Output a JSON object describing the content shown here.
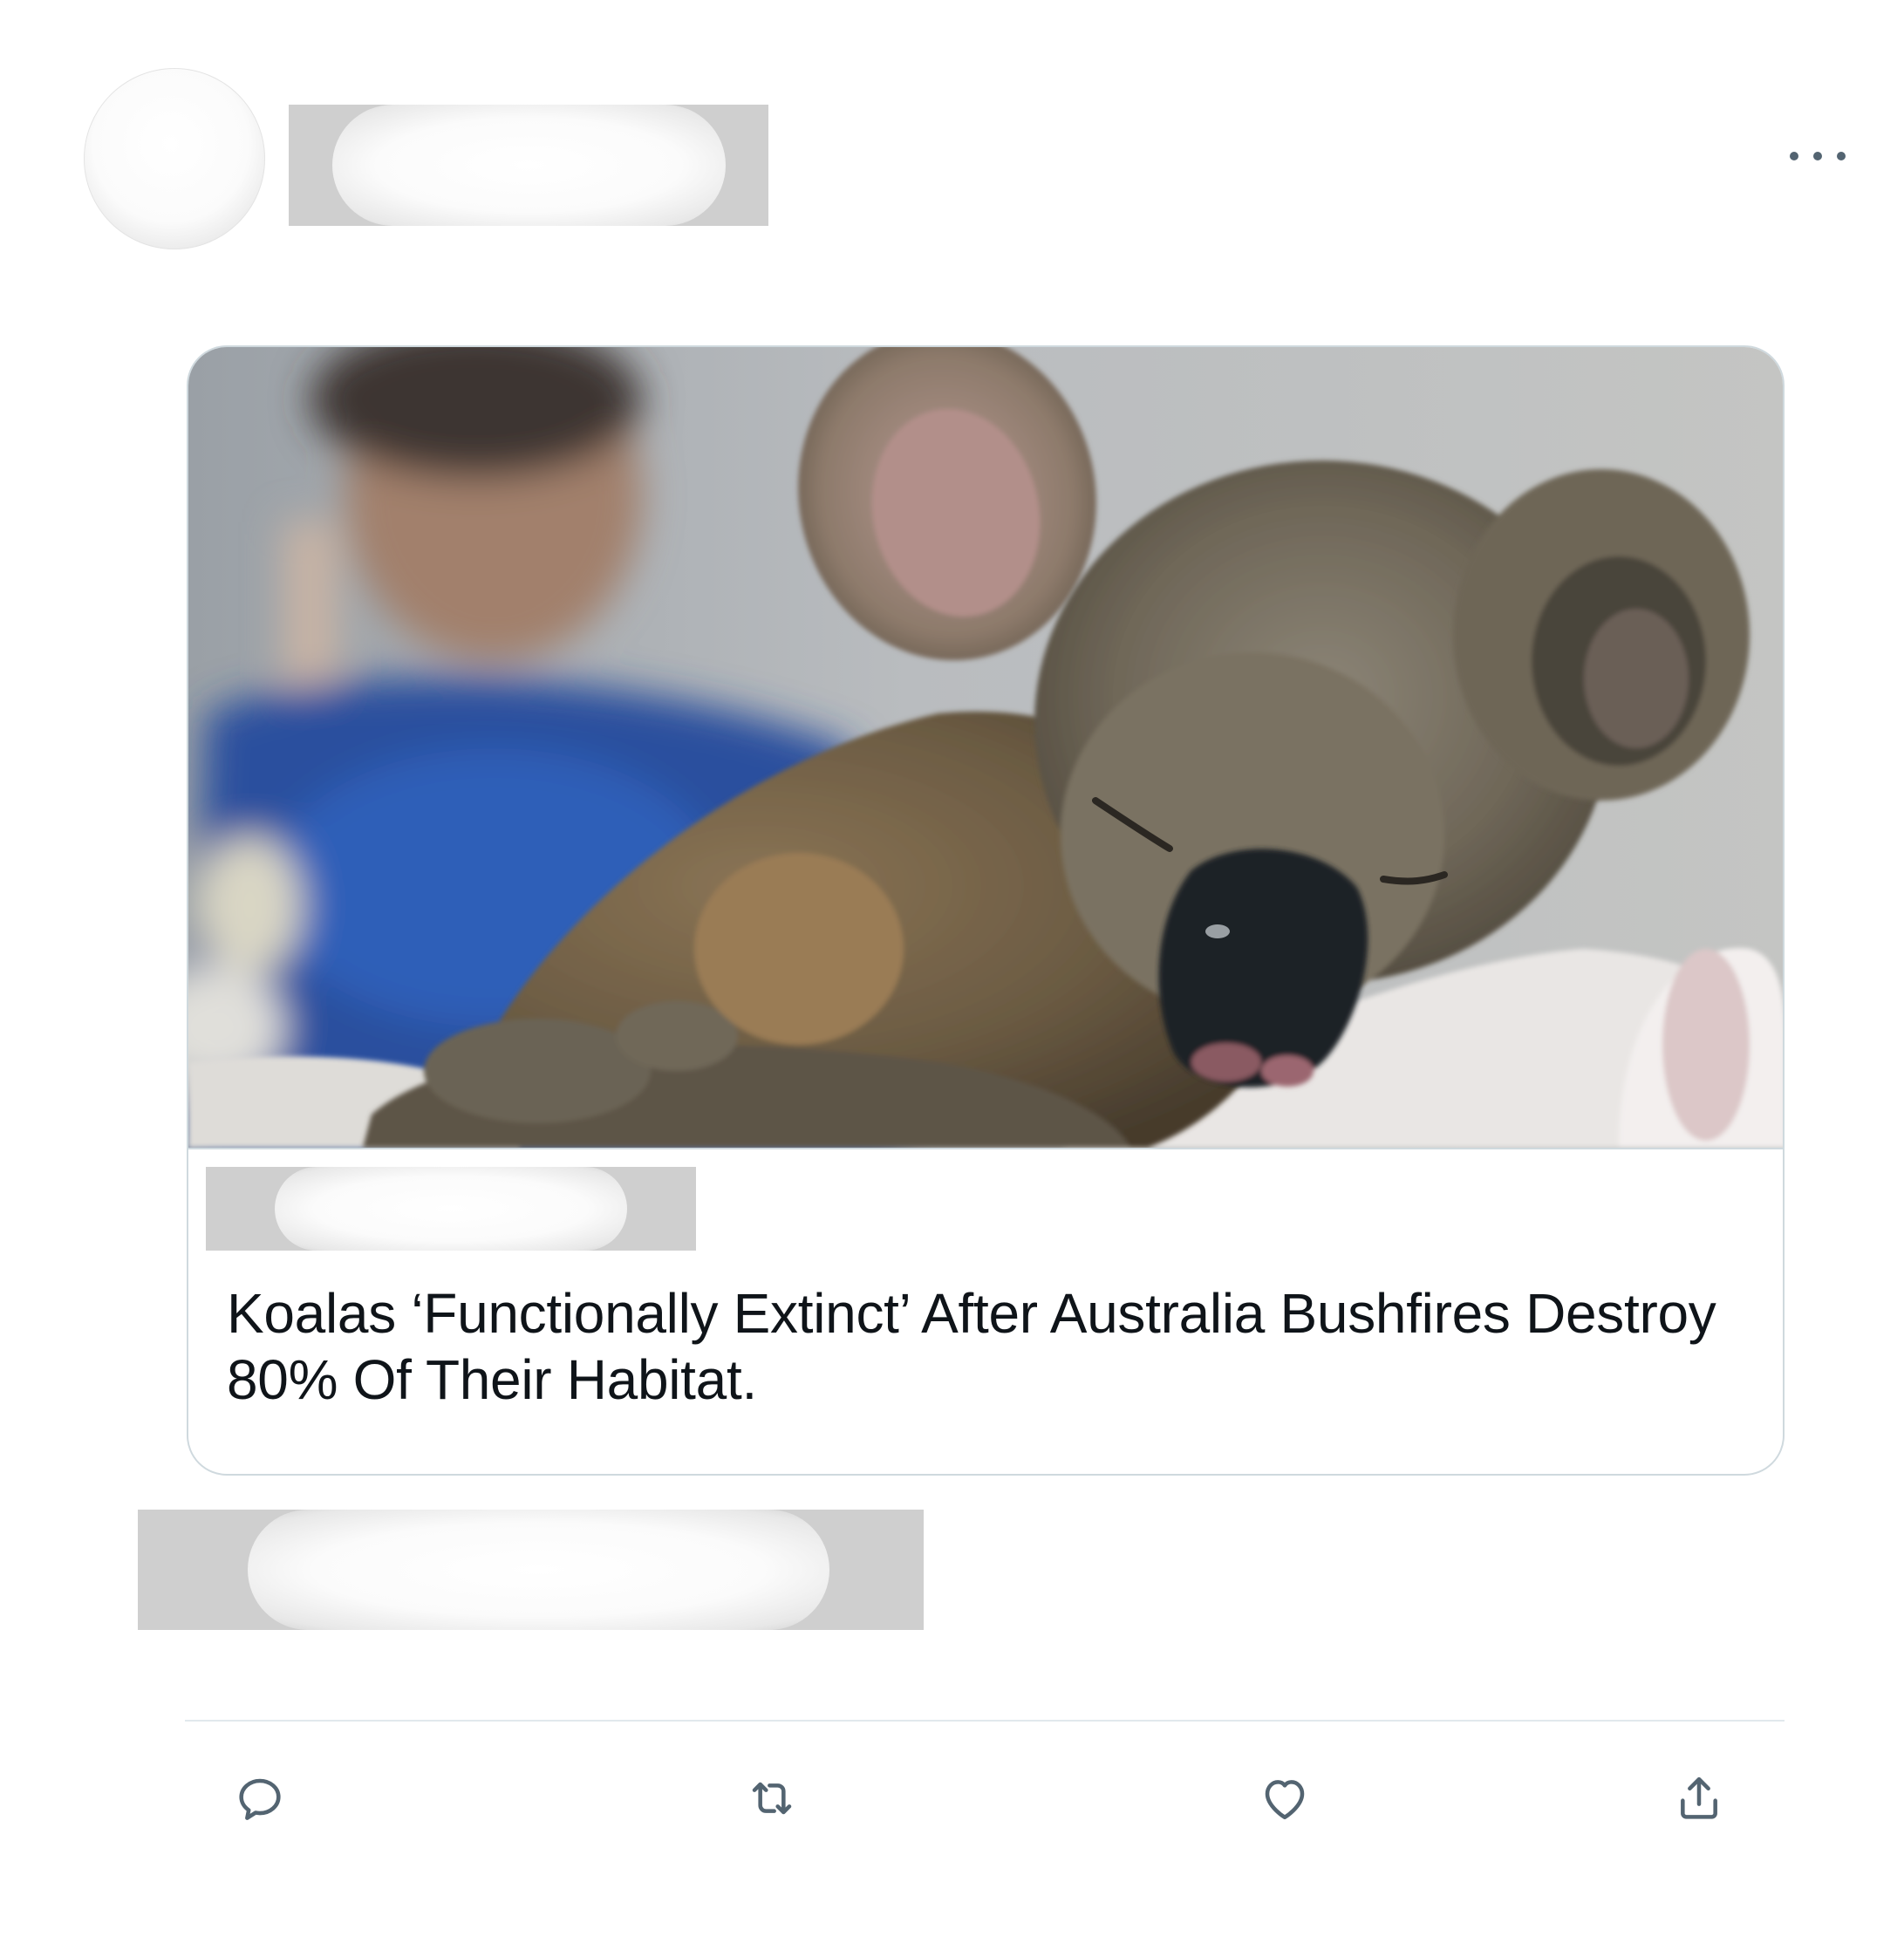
{
  "tweet": {
    "menu_icon": "more-horizontal-icon",
    "card": {
      "image_alt": "Injured koala resting on a white cloth, held by a rescuer",
      "title": "Koalas ‘Functionally Extinct’ After Australia Bushfires Destroy 80% Of Their Habitat."
    },
    "actions": [
      {
        "name": "reply",
        "icon": "reply-icon"
      },
      {
        "name": "retweet",
        "icon": "retweet-icon"
      },
      {
        "name": "like",
        "icon": "heart-icon"
      },
      {
        "name": "share",
        "icon": "share-icon"
      }
    ]
  },
  "colors": {
    "text": "#0f1419",
    "icon": "#536471",
    "border": "#cfd9de",
    "redaction": "#cfcfcf"
  }
}
